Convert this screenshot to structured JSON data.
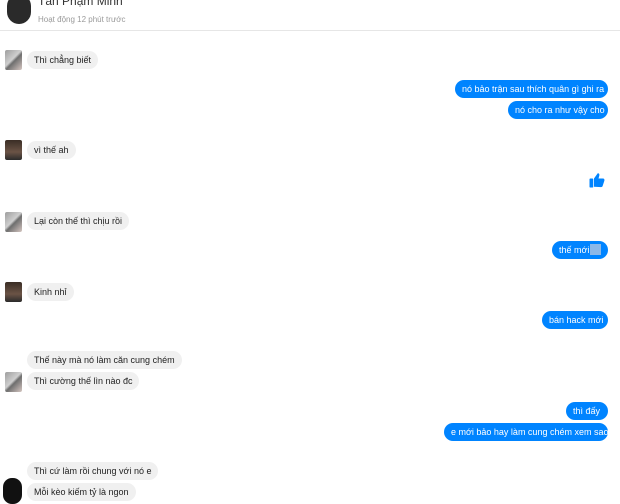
{
  "header": {
    "name": "Tân Phạm Minh",
    "status": "Hoạt động 12 phút trước"
  },
  "messages": {
    "m1": "Thì chẳng biết",
    "m2": "nó bảo trận sau thích quân gì ghi ra",
    "m3": "nó cho ra như vậy cho",
    "m4": "vì thế ah",
    "m5": "Lại còn thế thì chịu rồi",
    "m6": "thế mới",
    "m7": "Kinh nhỉ",
    "m8": "bán hack mới",
    "m9": "Thế này mà nó làm căn cung chém",
    "m10": "Thì cường thế lìn nào đc",
    "m11": "thì đấy",
    "m12": "e mới bảo hay làm cung chém xem sao",
    "m13": "Thì cứ làm rồi chung với nó e",
    "m14": "Mỗi kèo kiếm tỷ là ngon"
  },
  "icons": {
    "like": "thumbs-up-icon"
  },
  "colors": {
    "outgoing": "#0084ff",
    "incoming": "#f0f0f0"
  }
}
